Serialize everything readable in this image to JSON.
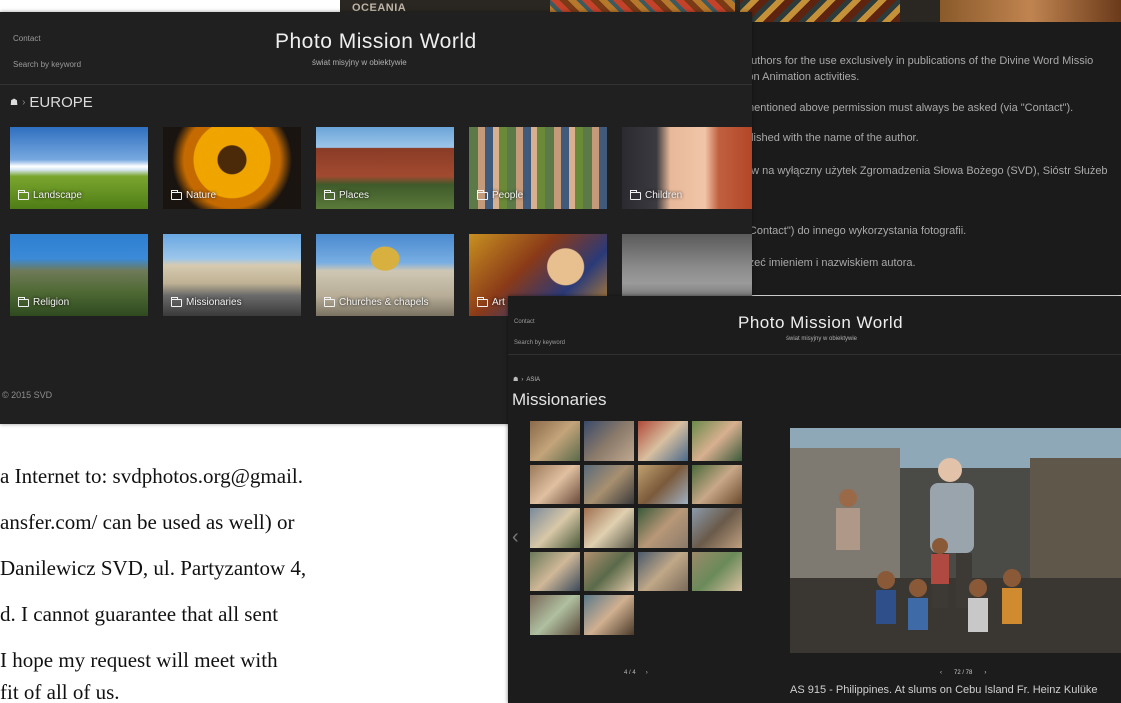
{
  "colors": {
    "panel_bg": "#202020",
    "text_light": "#eeeeee"
  },
  "rules_panel": {
    "section": "OCEANIA",
    "lines": [
      "authors for the use exclusively in publications of the Divine Word Missio",
      "ion Animation activities.",
      "mentioned above permission must always be asked (via \"Contact\").",
      "blished with the name of the author.",
      "ów na wyłączny użytek Zgromadzenia Słowa Bożego (SVD), Sióstr Służeb",
      "\"Contact\") do innego wykorzystania fotografii.",
      "rzeć imieniem i nazwiskiem autora."
    ]
  },
  "europe": {
    "nav": {
      "contact": "Contact",
      "search": "Search by keyword"
    },
    "title": "Photo Mission World",
    "subtitle": "świat misyjny w obiektywie",
    "breadcrumb_sep": "›",
    "section": "EUROPE",
    "tiles": [
      {
        "label": "Landscape",
        "icon": "folder-icon"
      },
      {
        "label": "Nature",
        "icon": "folder-icon"
      },
      {
        "label": "Places",
        "icon": "folder-icon"
      },
      {
        "label": "People",
        "icon": "folder-icon"
      },
      {
        "label": "Children",
        "icon": "folder-icon"
      },
      {
        "label": "Religion",
        "icon": "folder-icon"
      },
      {
        "label": "Missionaries",
        "icon": "folder-icon"
      },
      {
        "label": "Churches & chapels",
        "icon": "folder-icon"
      },
      {
        "label": "Art",
        "icon": "folder-icon"
      },
      {
        "label": "",
        "icon": ""
      }
    ],
    "footer": "© 2015 SVD"
  },
  "asia": {
    "nav": {
      "contact": "Contact",
      "search": "Search by keyword"
    },
    "title": "Photo Mission World",
    "subtitle": "świat misyjny w obiektywie",
    "breadcrumb_section": "ASIA",
    "page_title": "Missionaries",
    "grid_page": "4 / 4",
    "photo_counter": "72 / 78",
    "caption": "AS 915 - Philippines. At slums on Cebu Island Fr. Heinz Kulüke"
  },
  "letter_lines": [
    "a Internet to: svdphotos.org@gmail.",
    "ansfer.com/ can be used as well) or",
    "Danilewicz SVD, ul. Partyzantow 4,",
    "d. I cannot guarantee that all sent",
    " I hope my request will meet with",
    "fit of all of us."
  ]
}
